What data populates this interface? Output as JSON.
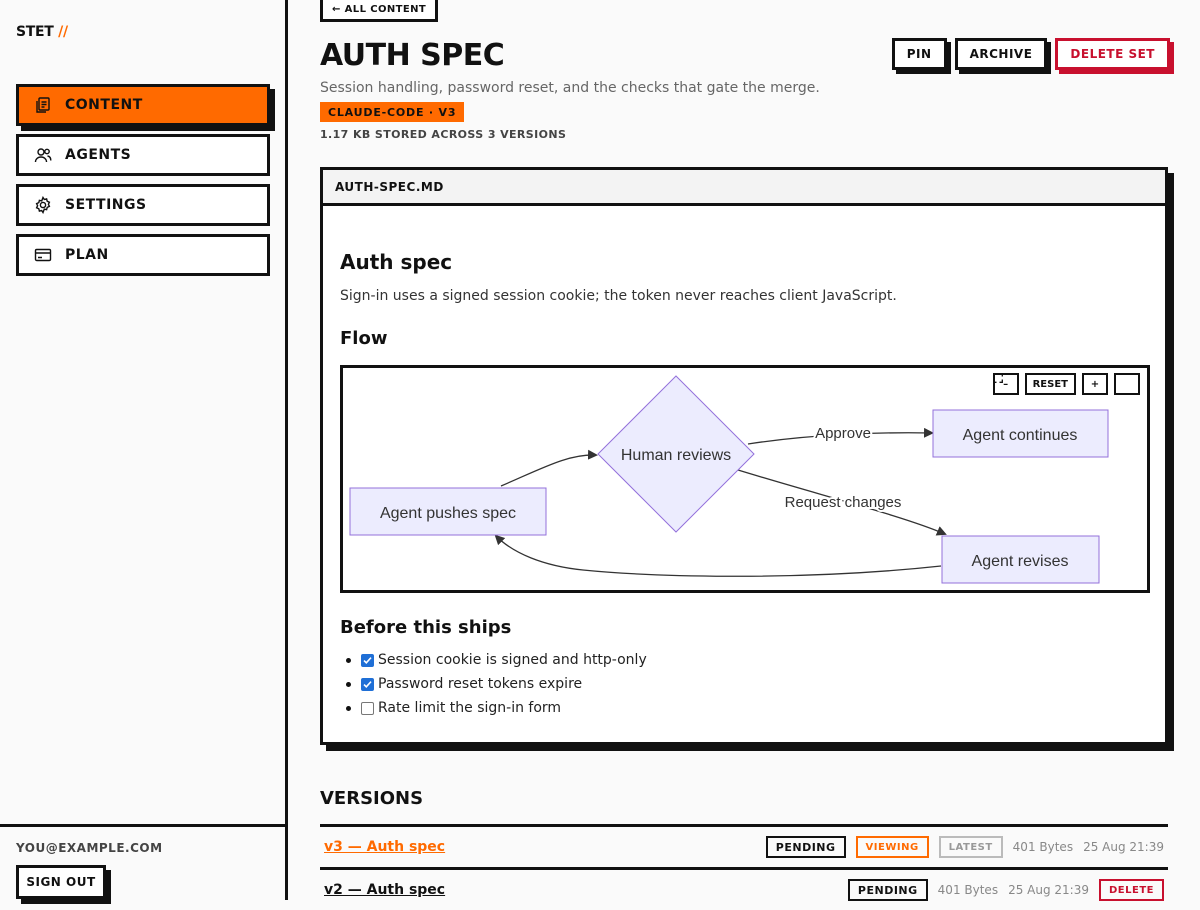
{
  "brand": {
    "name": "STET",
    "mark": "//"
  },
  "nav": [
    {
      "label": "CONTENT",
      "icon": "files-icon",
      "active": true
    },
    {
      "label": "AGENTS",
      "icon": "users-icon",
      "active": false
    },
    {
      "label": "SETTINGS",
      "icon": "gear-icon",
      "active": false
    },
    {
      "label": "PLAN",
      "icon": "card-icon",
      "active": false
    }
  ],
  "account": {
    "email": "YOU@EXAMPLE.COM",
    "signout_label": "SIGN OUT"
  },
  "header": {
    "back_label": "← ALL CONTENT",
    "title": "AUTH SPEC",
    "subtitle": "Session handling, password reset, and the checks that gate the merge.",
    "tag": "CLAUDE-CODE · V3",
    "meta": "1.17 KB STORED ACROSS 3 VERSIONS",
    "pin_label": "PIN",
    "archive_label": "ARCHIVE",
    "delete_label": "DELETE SET"
  },
  "file": {
    "name": "AUTH-SPEC.MD",
    "heading": "Auth spec",
    "intro": "Sign-in uses a signed session cookie; the token never reaches client JavaScript.",
    "flow_heading": "Flow",
    "diagram": {
      "zoom_out": "–",
      "reset": "RESET",
      "zoom_in": "+",
      "fullscreen_icon": "fullscreen-icon",
      "nodes": {
        "push": "Agent pushes spec",
        "review": "Human reviews",
        "continue": "Agent continues",
        "revise": "Agent revises"
      },
      "edges": {
        "approve": "Approve",
        "changes": "Request changes"
      },
      "colors": {
        "node_fill": "#ececfe",
        "node_stroke": "#9370db"
      }
    },
    "checks_heading": "Before this ships",
    "checks": [
      {
        "label": "Session cookie is signed and http-only",
        "checked": true
      },
      {
        "label": "Password reset tokens expire",
        "checked": true
      },
      {
        "label": "Rate limit the sign-in form",
        "checked": false
      }
    ]
  },
  "versions": {
    "title": "VERSIONS",
    "rows": [
      {
        "label": "v3 — Auth spec",
        "status": "PENDING",
        "viewing": "VIEWING",
        "latest": "LATEST",
        "size": "401 Bytes",
        "date": "25 Aug 21:39"
      },
      {
        "label": "v2 — Auth spec",
        "status": "PENDING",
        "size": "401 Bytes",
        "date": "25 Aug 21:39",
        "delete": "DELETE"
      }
    ]
  },
  "colors": {
    "accent": "#ff6a00",
    "danger": "#c8102e",
    "ink": "#111111"
  }
}
